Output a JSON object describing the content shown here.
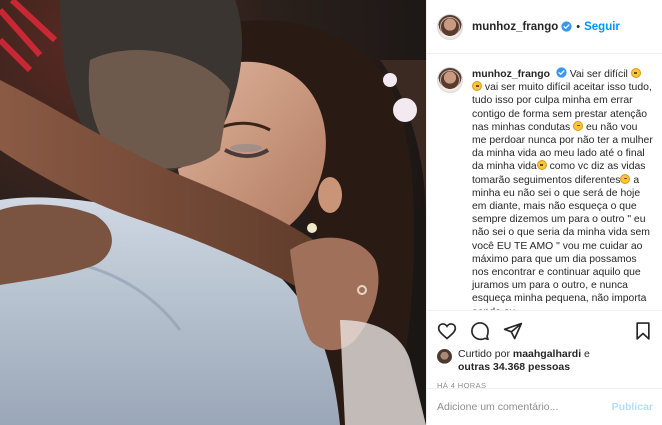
{
  "post": {
    "photo_alt": "",
    "username": "munhoz_frango",
    "follow_label": "Seguir",
    "separator": "•"
  },
  "caption": {
    "username": "munhoz_frango",
    "parts": [
      "Vai ser difícil ",
      " vai ser muito difícil aceitar isso tudo, tudo isso por culpa minha em errar contigo de forma sem prestar atenção nas minhas condutas ",
      " eu não vou me perdoar nunca por não ter a mulher da minha vida ao meu lado até o final da minha vida",
      " como vc diz as vidas tomarão seguimentos diferentes",
      " a minha eu não sei o que será de hoje em diante, mais não esqueça o que sempre dizemos um para o outro \" eu não sei o que seria da minha vida sem você EU TE AMO \" vou me cuidar ao máximo para que um dia possamos nos encontrar e continuar aquilo que juramos um para o outro, e nunca esqueça minha pequena, não importa aonde eu"
    ]
  },
  "likes": {
    "prefix": "Curtido por ",
    "first_user": "maahgalhardi",
    "connector": " e",
    "others": "outras 34.368 pessoas"
  },
  "timestamp": "HÁ 4 HORAS",
  "comment_box": {
    "placeholder": "Adicione um comentário...",
    "publish_label": "Publicar"
  },
  "colors": {
    "accent": "#0095f6",
    "publish_disabled": "#b2dffc",
    "verified": "#3897f0"
  },
  "icons": [
    "heart-icon",
    "comment-icon",
    "share-icon",
    "bookmark-icon",
    "verified-badge-icon",
    "emoji-icon"
  ]
}
